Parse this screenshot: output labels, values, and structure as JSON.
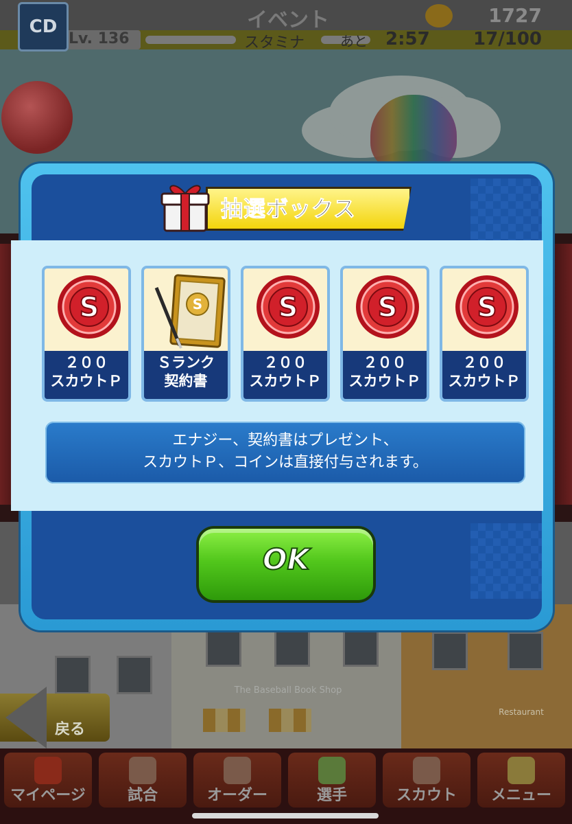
{
  "header": {
    "team_logo_text": "CD",
    "title": "イベント",
    "coin_count": "1727",
    "level_label": "Lv. 136",
    "stamina_label": "スタミナ",
    "ato_label": "あと",
    "timer": "2:57",
    "stamina_count": "17/100"
  },
  "background": {
    "shop_sign": "The Baseball Book Shop",
    "restaurant_sign": "Restaurant",
    "back_button_label": "戻る"
  },
  "dialog": {
    "title": "抽選ボックス",
    "rewards": [
      {
        "icon": "s-coin-icon",
        "line1": "２００",
        "line2": "スカウトＰ"
      },
      {
        "icon": "contract-icon",
        "line1": "Ｓランク",
        "line2": "契約書"
      },
      {
        "icon": "s-coin-icon",
        "line1": "２００",
        "line2": "スカウトＰ"
      },
      {
        "icon": "s-coin-icon",
        "line1": "２００",
        "line2": "スカウトＰ"
      },
      {
        "icon": "s-coin-icon",
        "line1": "２００",
        "line2": "スカウトＰ"
      }
    ],
    "notice_line1": "エナジー、契約書はプレゼント、",
    "notice_line2": "スカウトＰ、コインは直接付与されます。",
    "ok_label": "OK"
  },
  "nav": {
    "items": [
      {
        "label": "マイページ"
      },
      {
        "label": "試合"
      },
      {
        "label": "オーダー"
      },
      {
        "label": "選手"
      },
      {
        "label": "スカウト"
      },
      {
        "label": "メニュー"
      }
    ]
  },
  "colors": {
    "dialog_frame": "#4fc2ee",
    "dialog_fill": "#1b4f9c",
    "content_band": "#cfeefa",
    "title_banner": "#f3d40c",
    "ok_button": "#52c71c",
    "card_label_bg": "#17397a"
  }
}
